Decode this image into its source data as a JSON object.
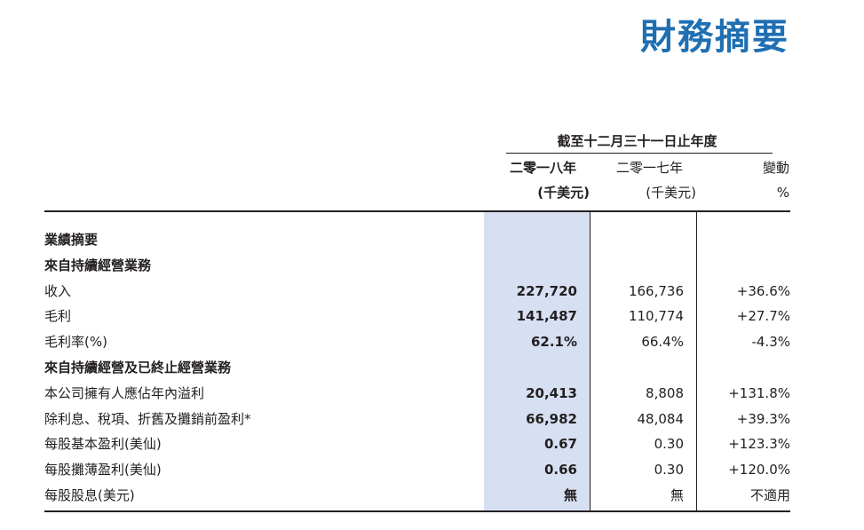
{
  "title": "財務摘要",
  "table": {
    "period_header": "截至十二月三十一日止年度",
    "columns": [
      {
        "year": "二零一八年",
        "unit": "(千美元)"
      },
      {
        "year": "二零一七年",
        "unit": "(千美元)"
      },
      {
        "year": "變動",
        "unit": "%"
      }
    ],
    "rows": [
      {
        "label": "業績摘要",
        "bold": true,
        "v2018": "",
        "v2017": "",
        "change": ""
      },
      {
        "label": "來自持續經營業務",
        "bold": true,
        "v2018": "",
        "v2017": "",
        "change": ""
      },
      {
        "label": "收入",
        "bold": false,
        "v2018": "227,720",
        "v2017": "166,736",
        "change": "+36.6%"
      },
      {
        "label": "毛利",
        "bold": false,
        "v2018": "141,487",
        "v2017": "110,774",
        "change": "+27.7%"
      },
      {
        "label": "毛利率(%)",
        "bold": false,
        "v2018": "62.1%",
        "v2017": "66.4%",
        "change": "-4.3%"
      },
      {
        "label": "來自持續經營及已終止經營業務",
        "bold": true,
        "v2018": "",
        "v2017": "",
        "change": ""
      },
      {
        "label": "本公司擁有人應佔年內溢利",
        "bold": false,
        "v2018": "20,413",
        "v2017": "8,808",
        "change": "+131.8%"
      },
      {
        "label": "除利息、稅項、折舊及攤銷前盈利*",
        "bold": false,
        "v2018": "66,982",
        "v2017": "48,084",
        "change": "+39.3%"
      },
      {
        "label": "每股基本盈利(美仙)",
        "bold": false,
        "v2018": "0.67",
        "v2017": "0.30",
        "change": "+123.3%"
      },
      {
        "label": "每股攤薄盈利(美仙)",
        "bold": false,
        "v2018": "0.66",
        "v2017": "0.30",
        "change": "+120.0%"
      },
      {
        "label": "每股股息(美元)",
        "bold": false,
        "v2018": "無",
        "v2017": "無",
        "change": "不適用"
      }
    ]
  },
  "colors": {
    "title": "#1f6fb2",
    "highlight": "#d7e0f2",
    "text": "#231f20"
  }
}
